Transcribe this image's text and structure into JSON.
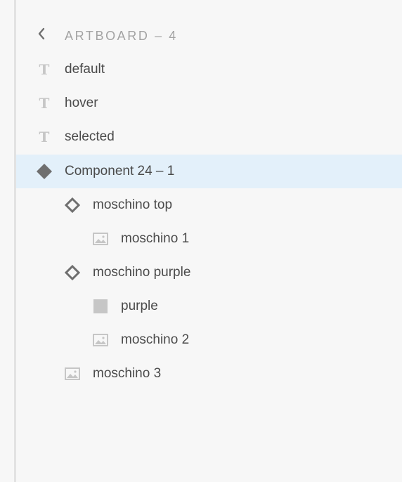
{
  "header": {
    "back_icon": "chevron-left-icon",
    "title": "ARTBOARD – 4"
  },
  "layers": [
    {
      "label": "default",
      "icon": "text-layer-icon",
      "depth": 0,
      "selected": false
    },
    {
      "label": "hover",
      "icon": "text-layer-icon",
      "depth": 0,
      "selected": false
    },
    {
      "label": "selected",
      "icon": "text-layer-icon",
      "depth": 0,
      "selected": false
    },
    {
      "label": "Component 24 – 1",
      "icon": "component-icon",
      "depth": 0,
      "selected": true
    },
    {
      "label": "moschino top",
      "icon": "component-instance-icon",
      "depth": 1,
      "selected": false
    },
    {
      "label": "moschino 1",
      "icon": "image-icon",
      "depth": 2,
      "selected": false
    },
    {
      "label": "moschino purple",
      "icon": "component-instance-icon",
      "depth": 1,
      "selected": false
    },
    {
      "label": "purple",
      "icon": "rectangle-icon",
      "depth": 2,
      "selected": false
    },
    {
      "label": "moschino 2",
      "icon": "image-icon",
      "depth": 2,
      "selected": false
    },
    {
      "label": "moschino 3",
      "icon": "image-icon",
      "depth": 1,
      "selected": false
    }
  ],
  "colors": {
    "selected_row": "#e3f0fa",
    "text": "#4a4a4a",
    "icon_gray": "#c6c6c6",
    "icon_dark": "#6f6f6f"
  }
}
